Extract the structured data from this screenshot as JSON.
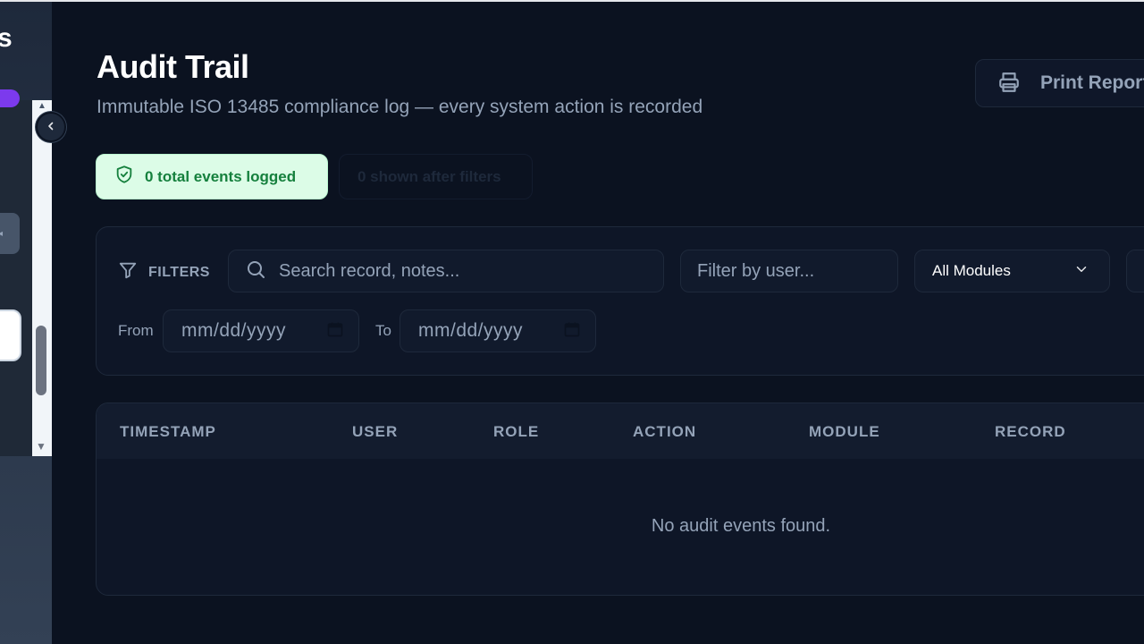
{
  "sidebar": {
    "brand_fragment": "s",
    "collapse_icon": "chevron-left-icon"
  },
  "header": {
    "title": "Audit Trail",
    "subtitle": "Immutable ISO 13485 compliance log — every system action is recorded",
    "print_label": "Print Report",
    "print_icon": "printer-icon"
  },
  "badges": {
    "total": "0 total events logged",
    "shown": "0 shown after filters"
  },
  "filters": {
    "label": "FILTERS",
    "search_placeholder": "Search record, notes...",
    "user_placeholder": "Filter by user...",
    "module_selected": "All Modules",
    "from_label": "From",
    "to_label": "To",
    "date_placeholder": "mm/dd/yyyy"
  },
  "table": {
    "columns": [
      "TIMESTAMP",
      "USER",
      "ROLE",
      "ACTION",
      "MODULE",
      "RECORD"
    ],
    "empty_message": "No audit events found."
  },
  "colors": {
    "background": "#0b1220",
    "panel": "#0e1627",
    "success_bg": "#dcfce7",
    "success_text": "#15803d"
  }
}
